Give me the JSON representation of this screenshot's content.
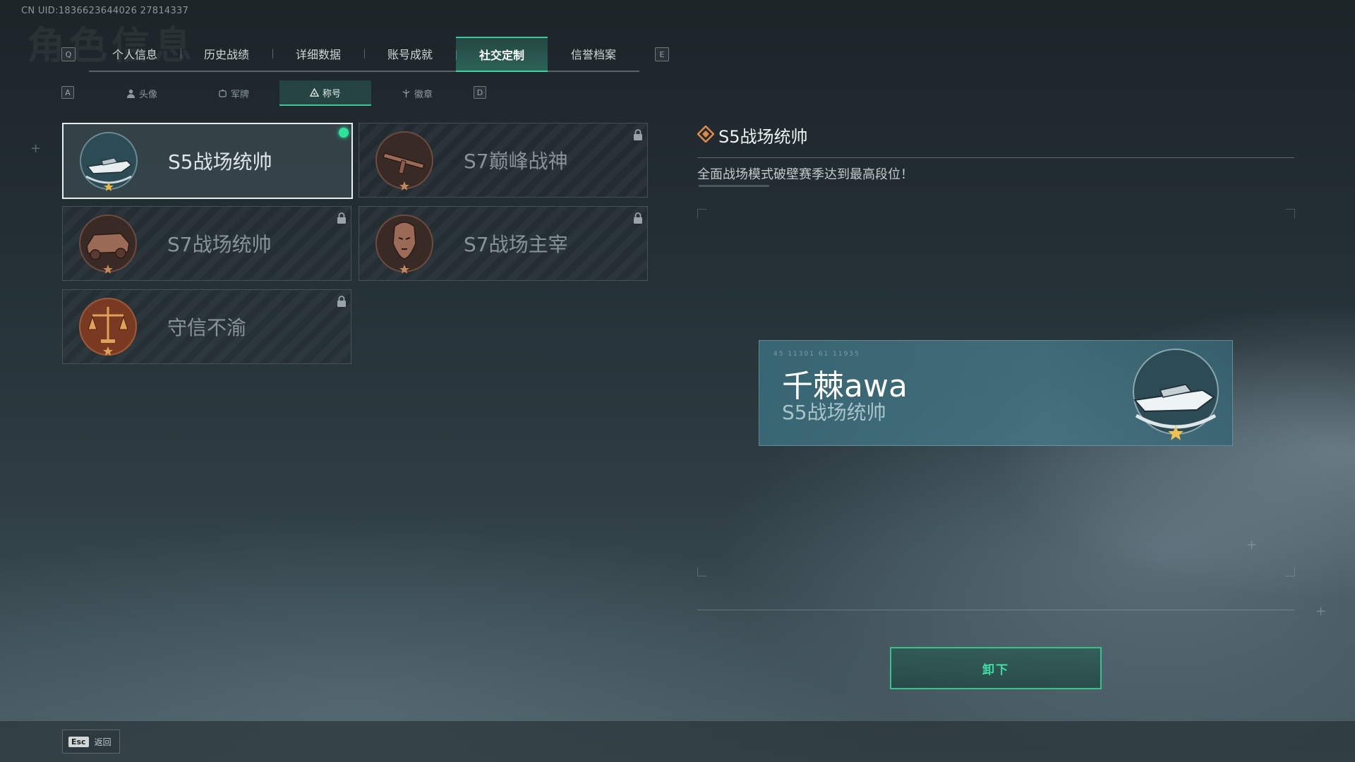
{
  "uid": "CN UID:1836623644026 27814337",
  "top_nav": {
    "prev_key": "Q",
    "next_key": "E",
    "tabs": [
      "个人信息",
      "历史战绩",
      "详细数据",
      "账号成就",
      "社交定制",
      "信誉档案"
    ],
    "active": "社交定制"
  },
  "sub_nav": {
    "prev_key": "A",
    "next_key": "D",
    "tabs": [
      {
        "label": "头像",
        "icon": "person-icon"
      },
      {
        "label": "军牌",
        "icon": "dogtag-icon"
      },
      {
        "label": "称号",
        "icon": "title-icon"
      },
      {
        "label": "徽章",
        "icon": "badge-icon"
      }
    ],
    "active": "称号"
  },
  "titles": [
    {
      "name": "S5战场统帅",
      "emblem": "speedboat-emblem",
      "locked": false,
      "selected": true,
      "equipped": true
    },
    {
      "name": "S7巅峰战神",
      "emblem": "rifle-emblem",
      "locked": true,
      "selected": false
    },
    {
      "name": "S7战场统帅",
      "emblem": "armored-vehicle-emblem",
      "locked": true,
      "selected": false
    },
    {
      "name": "S7战场主宰",
      "emblem": "warrior-emblem",
      "locked": true,
      "selected": false
    },
    {
      "name": "守信不渝",
      "emblem": "scales-emblem",
      "locked": true,
      "selected": false
    }
  ],
  "detail": {
    "title": "S5战场统帅",
    "description": "全面战场模式破壁赛季达到最高段位！"
  },
  "preview": {
    "player_name": "千棘awa",
    "title": "S5战场统帅",
    "deco_text": "45 11301  61 11935"
  },
  "unequip_label": "卸下",
  "footer": {
    "esc_key": "Esc",
    "back_label": "返回"
  },
  "colors": {
    "accent": "#3fc49a",
    "equipped_dot": "#2de39a",
    "plate": "#467a88"
  }
}
